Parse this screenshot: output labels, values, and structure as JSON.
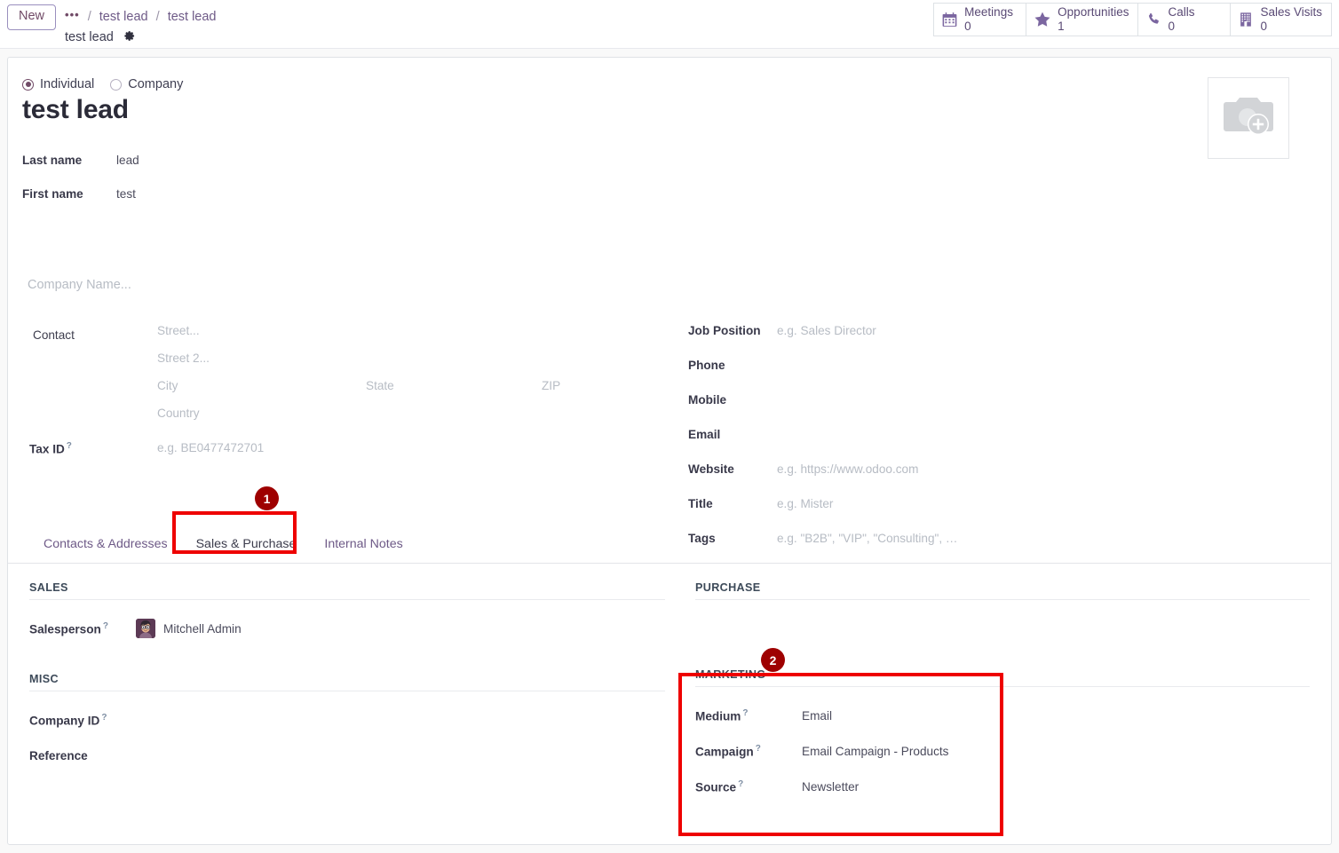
{
  "control_panel": {
    "new_button": "New",
    "breadcrumb": {
      "dots": "•••",
      "sep1": "/",
      "item1": "test lead",
      "sep2": "/",
      "item2": "test lead",
      "record_title": "test lead",
      "settings_icon": "gear-icon"
    },
    "stat_buttons": [
      {
        "icon": "calendar-icon",
        "label": "Meetings",
        "value": "0"
      },
      {
        "icon": "star-icon",
        "label": "Opportunities",
        "value": "1"
      },
      {
        "icon": "phone-icon",
        "label": "Calls",
        "value": "0"
      },
      {
        "icon": "building-icon",
        "label": "Sales Visits",
        "value": "0"
      }
    ]
  },
  "form": {
    "type_radio": {
      "individual": "Individual",
      "company": "Company",
      "selected": "Individual"
    },
    "record_name": "test lead",
    "name_fields": [
      {
        "label": "Last name",
        "value": "lead"
      },
      {
        "label": "First name",
        "value": "test"
      }
    ],
    "company_name_placeholder": "Company Name...",
    "address": {
      "label": "Contact",
      "street": "Street...",
      "street2": "Street 2...",
      "city": "City",
      "state": "State",
      "zip": "ZIP",
      "country": "Country"
    },
    "tax_id": {
      "label": "Tax ID",
      "hint": "?",
      "placeholder": "e.g. BE0477472701"
    },
    "right_fields": [
      {
        "label": "Job Position",
        "placeholder": "e.g. Sales Director",
        "value": ""
      },
      {
        "label": "Phone",
        "placeholder": "",
        "value": ""
      },
      {
        "label": "Mobile",
        "placeholder": "",
        "value": ""
      },
      {
        "label": "Email",
        "placeholder": "",
        "value": ""
      },
      {
        "label": "Website",
        "placeholder": "e.g. https://www.odoo.com",
        "value": ""
      },
      {
        "label": "Title",
        "placeholder": "e.g. Mister",
        "value": ""
      },
      {
        "label": "Tags",
        "placeholder": "e.g. \"B2B\", \"VIP\", \"Consulting\", …",
        "value": ""
      }
    ],
    "photo_placeholder_icon": "camera-add-icon"
  },
  "tabs": [
    {
      "label": "Contacts & Addresses",
      "active": false
    },
    {
      "label": "Sales & Purchase",
      "active": true
    },
    {
      "label": "Internal Notes",
      "active": false
    }
  ],
  "tab_content": {
    "sales": {
      "title": "SALES",
      "salesperson": {
        "label": "Salesperson",
        "hint": "?",
        "value": "Mitchell Admin",
        "avatar": "user-avatar"
      }
    },
    "misc": {
      "title": "MISC",
      "fields": [
        {
          "label": "Company ID",
          "hint": "?",
          "value": ""
        },
        {
          "label": "Reference",
          "hint": "",
          "value": ""
        }
      ]
    },
    "purchase": {
      "title": "PURCHASE"
    },
    "marketing": {
      "title": "MARKETING",
      "fields": [
        {
          "label": "Medium",
          "hint": "?",
          "value": "Email"
        },
        {
          "label": "Campaign",
          "hint": "?",
          "value": "Email Campaign - Products"
        },
        {
          "label": "Source",
          "hint": "?",
          "value": "Newsletter"
        }
      ]
    }
  },
  "annotations": [
    {
      "number": "1",
      "target": "Sales & Purchase tab"
    },
    {
      "number": "2",
      "target": "MARKETING section"
    }
  ],
  "colors": {
    "accent": "#714B67",
    "link": "#6e5a87",
    "annotation_border": "#ee0000",
    "annotation_badge": "#9e0000"
  }
}
